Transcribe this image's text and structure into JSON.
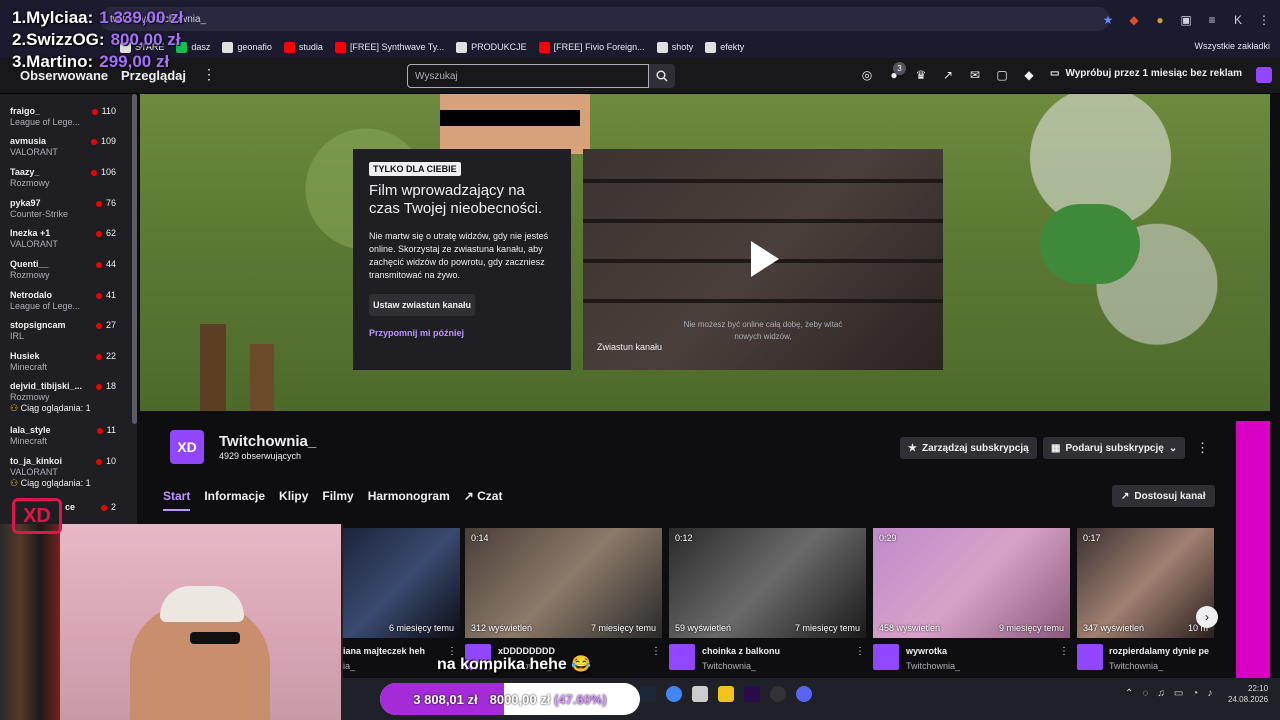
{
  "browser": {
    "url": "twitch.tv/twitchownia_",
    "bookmarks": [
      "STARE",
      "dasz",
      "geonafio",
      "studia",
      "[FREE] Synthwave Ty...",
      "PRODUKCJE",
      "[FREE] Fivio Foreign...",
      "shoty",
      "efekty"
    ],
    "bookmarks_all": "Wszystkie zakładki",
    "profile_letter": "K"
  },
  "ranking": [
    {
      "label": "1.Mylciaa:",
      "amount": "1 339,00 zł"
    },
    {
      "label": "2.SwizzOG:",
      "amount": "800,00 zł"
    },
    {
      "label": "3.Martino:",
      "amount": "299,00 zł"
    }
  ],
  "nav": {
    "following": "Obserwowane",
    "browse": "Przeglądaj",
    "search_placeholder": "Wyszukaj",
    "notifications_count": "3",
    "try_free": "Wypróbuj przez 1 miesiąc bez reklam"
  },
  "sidebar": {
    "channels": [
      {
        "name": "fraigo_",
        "game": "League of Lege...",
        "viewers": "110"
      },
      {
        "name": "avmusia",
        "game": "VALORANT",
        "viewers": "109"
      },
      {
        "name": "Taazy_",
        "game": "Rozmowy",
        "viewers": "106"
      },
      {
        "name": "pyka97",
        "game": "Counter-Strike",
        "viewers": "76"
      },
      {
        "name": "Inezka +1",
        "game": "VALORANT",
        "viewers": "62"
      },
      {
        "name": "Quenti__",
        "game": "Rozmowy",
        "viewers": "44"
      },
      {
        "name": "Netrodalo",
        "game": "League of Lege...",
        "viewers": "41"
      },
      {
        "name": "stopsigncam",
        "game": "IRL",
        "viewers": "27"
      },
      {
        "name": "Husiek",
        "game": "Minecraft",
        "viewers": "22"
      },
      {
        "name": "dejvid_tibijski_...",
        "game": "Rozmowy",
        "viewers": "18",
        "extra": "Ciąg oglądania: 1"
      },
      {
        "name": "lala_style",
        "game": "Minecraft",
        "viewers": "11"
      },
      {
        "name": "to_ja_kinkoi",
        "game": "VALORANT",
        "viewers": "10",
        "extra": "Ciąg oglądania: 1"
      },
      {
        "name": "ce",
        "game": "",
        "viewers": "2"
      }
    ]
  },
  "promo": {
    "tag": "TYLKO DLA CIEBIE",
    "title": "Film wprowadzający na czas Twojej nieobecności.",
    "desc": "Nie martw się o utratę widzów, gdy nie jesteś online. Skorzystaj ze zwiastuna kanału, aby zachęcić widzów do powrotu, gdy zaczniesz transmitować na żywo.",
    "set_button": "Ustaw zwiastun kanału",
    "remind": "Przypomnij mi później",
    "trailer_label": "Zwiastun kanału",
    "trailer_sub": "Nie możesz być online całą dobę, żeby witać nowych widzów,"
  },
  "channel": {
    "logo_text": "XD",
    "name": "Twitchownia_",
    "followers": "4929 obserwujących",
    "manage_sub": "Zarządzaj subskrypcją",
    "gift_sub": "Podaruj subskrypcję",
    "customize": "Dostosuj kanał",
    "tabs": [
      "Start",
      "Informacje",
      "Klipy",
      "Filmy",
      "Harmonogram",
      "Czat"
    ]
  },
  "clips": [
    {
      "duration": "",
      "views": "",
      "age": "6 miesięcy temu",
      "title": "iana majteczek heh",
      "channel": "ia_"
    },
    {
      "duration": "0:14",
      "views": "312 wyświetleń",
      "age": "7 miesięcy temu",
      "title": "xDDDDDDDD",
      "channel": "Twitchownia_"
    },
    {
      "duration": "0:12",
      "views": "59 wyświetleń",
      "age": "7 miesięcy temu",
      "title": "choinka z balkonu",
      "channel": "Twitchownia_"
    },
    {
      "duration": "0:29",
      "views": "458 wyświetleń",
      "age": "9 miesięcy temu",
      "title": "wywrotka",
      "channel": "Twitchownia_"
    },
    {
      "duration": "0:17",
      "views": "347 wyświetleń",
      "age": "10 m",
      "title": "rozpierdalamy dynie pe",
      "channel": "Twitchownia_"
    }
  ],
  "overlay": {
    "caption": "na kompika hehe 😂",
    "goal_current": "3 808,01 zł",
    "goal_target": "8000,00 zł",
    "goal_percent": "(47.60%)",
    "goal_fraction": 0.476,
    "xd_logo": "XD"
  },
  "taskbar": {
    "time": "22:10",
    "date": "24.08.2026"
  }
}
